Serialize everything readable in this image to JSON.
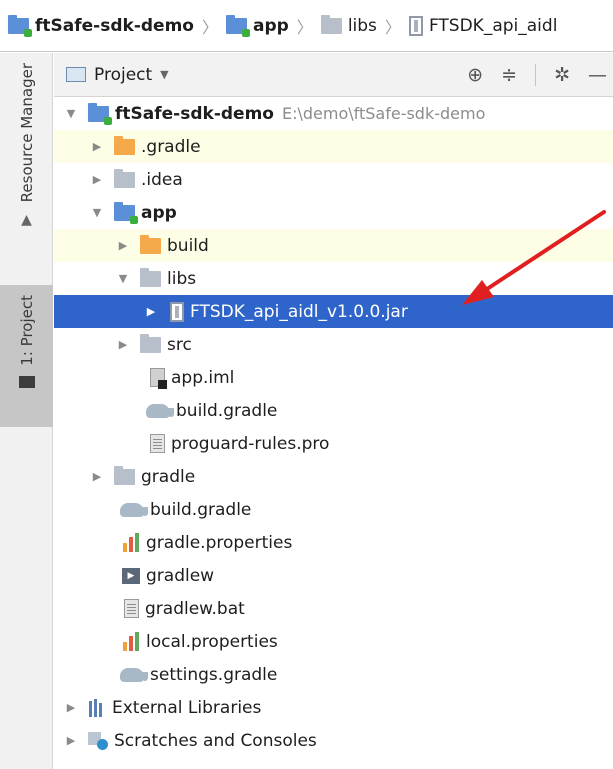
{
  "breadcrumb": [
    {
      "label": "ftSafe-sdk-demo",
      "icon": "module-folder-icon",
      "bold": true
    },
    {
      "label": "app",
      "icon": "module-folder-icon",
      "bold": true
    },
    {
      "label": "libs",
      "icon": "folder-icon",
      "bold": false
    },
    {
      "label": "FTSDK_api_aidl",
      "icon": "jar-icon",
      "bold": false
    }
  ],
  "sidebar": {
    "resource_manager_label": "Resource Manager",
    "project_label": "1: Project"
  },
  "panel": {
    "view_label": "Project",
    "dropdown_icon": "caret-down-icon",
    "tools": [
      "locate-icon",
      "collapse-all-icon",
      "gear-icon",
      "minimize-icon"
    ]
  },
  "tree": [
    {
      "label": "ftSafe-sdk-demo",
      "path": "E:\\demo\\ftSafe-sdk-demo",
      "icon": "module-folder-icon",
      "level": 0,
      "expanded": true,
      "bold": true
    },
    {
      "label": ".gradle",
      "icon": "excluded-folder-icon",
      "level": 1,
      "expanded": false
    },
    {
      "label": ".idea",
      "icon": "folder-icon",
      "level": 1,
      "expanded": false
    },
    {
      "label": "app",
      "icon": "module-folder-icon",
      "level": 1,
      "expanded": true,
      "bold": true
    },
    {
      "label": "build",
      "icon": "excluded-folder-icon",
      "level": 2,
      "expanded": false
    },
    {
      "label": "libs",
      "icon": "folder-icon",
      "level": 2,
      "expanded": true
    },
    {
      "label": "FTSDK_api_aidl_v1.0.0.jar",
      "icon": "jar-icon",
      "level": 3,
      "expanded": false,
      "selected": true
    },
    {
      "label": "src",
      "icon": "folder-icon",
      "level": 2,
      "expanded": false
    },
    {
      "label": "app.iml",
      "icon": "iml-file-icon",
      "level": 2
    },
    {
      "label": "build.gradle",
      "icon": "gradle-icon",
      "level": 2
    },
    {
      "label": "proguard-rules.pro",
      "icon": "text-file-icon",
      "level": 2
    },
    {
      "label": "gradle",
      "icon": "folder-icon",
      "level": 1,
      "expanded": false
    },
    {
      "label": "build.gradle",
      "icon": "gradle-icon",
      "level": 1
    },
    {
      "label": "gradle.properties",
      "icon": "properties-icon",
      "level": 1
    },
    {
      "label": "gradlew",
      "icon": "executable-icon",
      "level": 1
    },
    {
      "label": "gradlew.bat",
      "icon": "text-file-icon",
      "level": 1
    },
    {
      "label": "local.properties",
      "icon": "properties-icon",
      "level": 1
    },
    {
      "label": "settings.gradle",
      "icon": "gradle-icon",
      "level": 1
    },
    {
      "label": "External Libraries",
      "icon": "libraries-icon",
      "level": 0,
      "expanded": false
    },
    {
      "label": "Scratches and Consoles",
      "icon": "scratches-icon",
      "level": 0,
      "expanded": false
    }
  ],
  "colors": {
    "selection": "#2f65ca",
    "highlight_row": "#fefde5",
    "annotation_arrow": "#e02020"
  }
}
